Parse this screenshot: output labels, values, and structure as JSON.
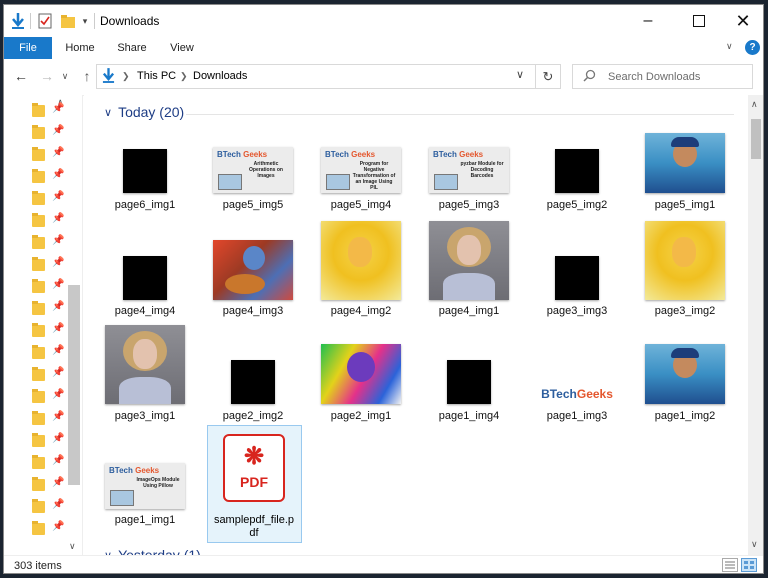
{
  "window": {
    "title": "Downloads"
  },
  "ribbon": {
    "tabs": [
      "File",
      "Home",
      "Share",
      "View"
    ]
  },
  "address": {
    "root": "This PC",
    "folder": "Downloads"
  },
  "search": {
    "placeholder": "Search Downloads"
  },
  "groups": [
    {
      "label": "Today (20)"
    },
    {
      "label": "Yesterday (1)"
    }
  ],
  "files": [
    {
      "name": "page6_img1",
      "thumb": "black"
    },
    {
      "name": "page5_img5",
      "thumb": "btechgeeks",
      "caption": "Arithmetic Operations on Images"
    },
    {
      "name": "page5_img4",
      "thumb": "btechgeeks",
      "caption": "Program for Negative Transformation of an Image Using PIL"
    },
    {
      "name": "page5_img3",
      "thumb": "btechgeeks",
      "caption": "pyzbar Module for Decoding Barcodes"
    },
    {
      "name": "page5_img2",
      "thumb": "black"
    },
    {
      "name": "page5_img1",
      "thumb": "photo-cricketer"
    },
    {
      "name": "page4_img4",
      "thumb": "black"
    },
    {
      "name": "page4_img3",
      "thumb": "photo-guitarist"
    },
    {
      "name": "page4_img2",
      "thumb": "photo-yellow"
    },
    {
      "name": "page4_img1",
      "thumb": "photo-woman"
    },
    {
      "name": "page3_img3",
      "thumb": "black"
    },
    {
      "name": "page3_img2",
      "thumb": "photo-yellow"
    },
    {
      "name": "page3_img1",
      "thumb": "photo-woman"
    },
    {
      "name": "page2_img2",
      "thumb": "black"
    },
    {
      "name": "page2_img1",
      "thumb": "photo-colorful"
    },
    {
      "name": "page1_img4",
      "thumb": "black"
    },
    {
      "name": "page1_img3",
      "thumb": "btechgeeks-logo"
    },
    {
      "name": "page1_img2",
      "thumb": "photo-cricketer"
    },
    {
      "name": "page1_img1",
      "thumb": "btechgeeks",
      "caption": "ImageOps Module Using Pillow"
    },
    {
      "name": "samplepdf_file.pdf",
      "thumb": "pdf-icon",
      "icon_text": "PDF"
    }
  ],
  "brand": {
    "part1": "BTech",
    "part2": "Geeks"
  },
  "status": {
    "count": "303 items"
  },
  "colors": {
    "accent": "#1979ca",
    "group_header": "#1e3d85",
    "pdf_red": "#d8251e",
    "selection": "#e5f3fb"
  }
}
